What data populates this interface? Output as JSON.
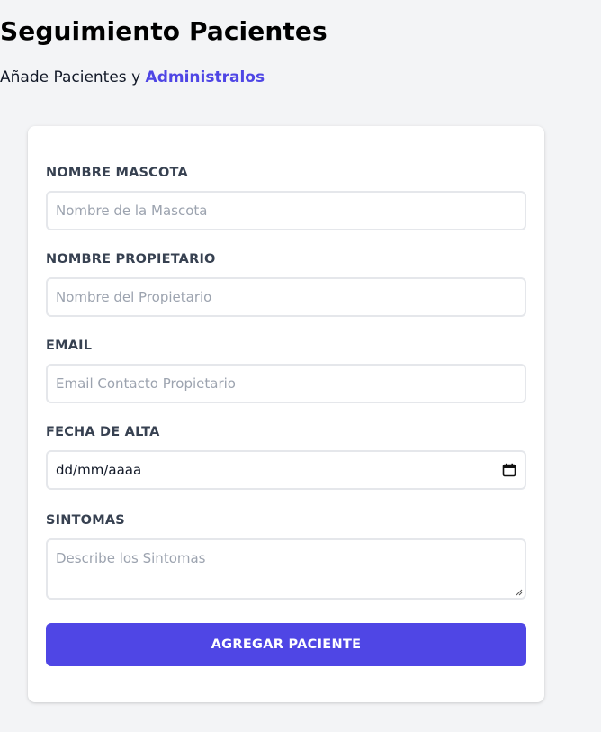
{
  "header": {
    "title": "Seguimiento Pacientes",
    "subtitle_prefix": "Añade Pacientes y ",
    "subtitle_accent": "Administralos"
  },
  "form": {
    "pet_name": {
      "label": "NOMBRE MASCOTA",
      "placeholder": "Nombre de la Mascota"
    },
    "owner_name": {
      "label": "NOMBRE PROPIETARIO",
      "placeholder": "Nombre del Propietario"
    },
    "email": {
      "label": "EMAIL",
      "placeholder": "Email Contacto Propietario"
    },
    "discharge_date": {
      "label": "FECHA DE ALTA",
      "value": "dd/mm/aaaa",
      "icon": "calendar-icon"
    },
    "symptoms": {
      "label": "SINTOMAS",
      "placeholder": "Describe los Sintomas"
    },
    "submit_label": "AGREGAR PACIENTE"
  },
  "colors": {
    "accent": "#4f46e5",
    "background": "#f3f4f6",
    "card": "#ffffff"
  }
}
